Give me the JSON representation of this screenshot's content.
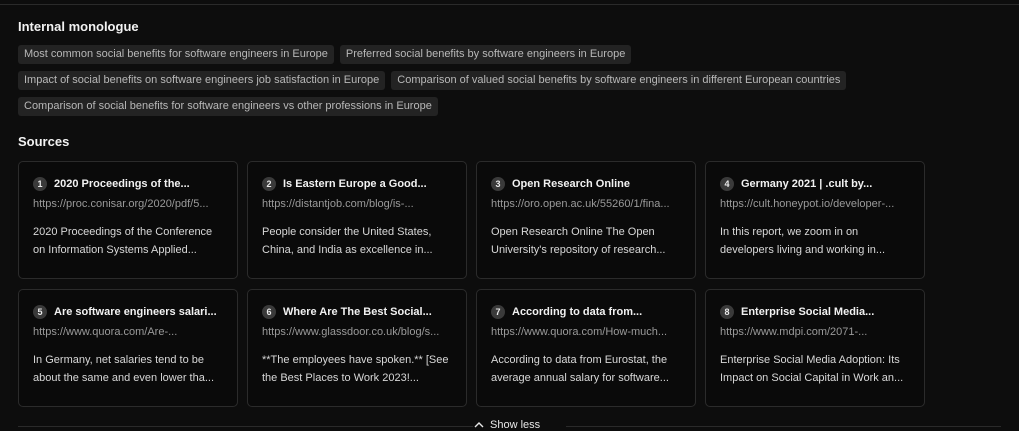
{
  "monologue": {
    "title": "Internal monologue",
    "queries": [
      [
        "Most common social benefits for software engineers in Europe",
        "Preferred social benefits by software engineers in Europe"
      ],
      [
        "Impact of social benefits on software engineers job satisfaction in Europe",
        "Comparison of valued social benefits by software engineers in different European countries"
      ],
      [
        "Comparison of social benefits for software engineers vs other professions in Europe"
      ]
    ]
  },
  "sources": {
    "title": "Sources",
    "items": [
      {
        "num": "1",
        "title": "2020 Proceedings of the...",
        "url": "https://proc.conisar.org/2020/pdf/5...",
        "snippet": "2020 Proceedings of the Conference on Information Systems Applied..."
      },
      {
        "num": "2",
        "title": "Is Eastern Europe a Good...",
        "url": "https://distantjob.com/blog/is-...",
        "snippet": "People consider the United States, China, and India as excellence in..."
      },
      {
        "num": "3",
        "title": "Open Research Online",
        "url": "https://oro.open.ac.uk/55260/1/fina...",
        "snippet": "Open Research Online The Open University's repository of research..."
      },
      {
        "num": "4",
        "title": "Germany 2021 | .cult by...",
        "url": "https://cult.honeypot.io/developer-...",
        "snippet": "In this report, we zoom in on developers living and working in..."
      },
      {
        "num": "5",
        "title": "Are software engineers salari...",
        "url": "https://www.quora.com/Are-...",
        "snippet": "In Germany, net salaries tend to be about the same and even lower tha..."
      },
      {
        "num": "6",
        "title": "Where Are The Best Social...",
        "url": "https://www.glassdoor.co.uk/blog/s...",
        "snippet": "**The employees have spoken.** [See the Best Places to Work 2023!..."
      },
      {
        "num": "7",
        "title": "According to data from...",
        "url": "https://www.quora.com/How-much...",
        "snippet": "According to data from Eurostat, the average annual salary for software..."
      },
      {
        "num": "8",
        "title": "Enterprise Social Media...",
        "url": "https://www.mdpi.com/2071-...",
        "snippet": "Enterprise Social Media Adoption: Its Impact on Social Capital in Work an..."
      }
    ],
    "toggle_label": "Show less",
    "toggle_icon": "chevron-up-icon"
  }
}
